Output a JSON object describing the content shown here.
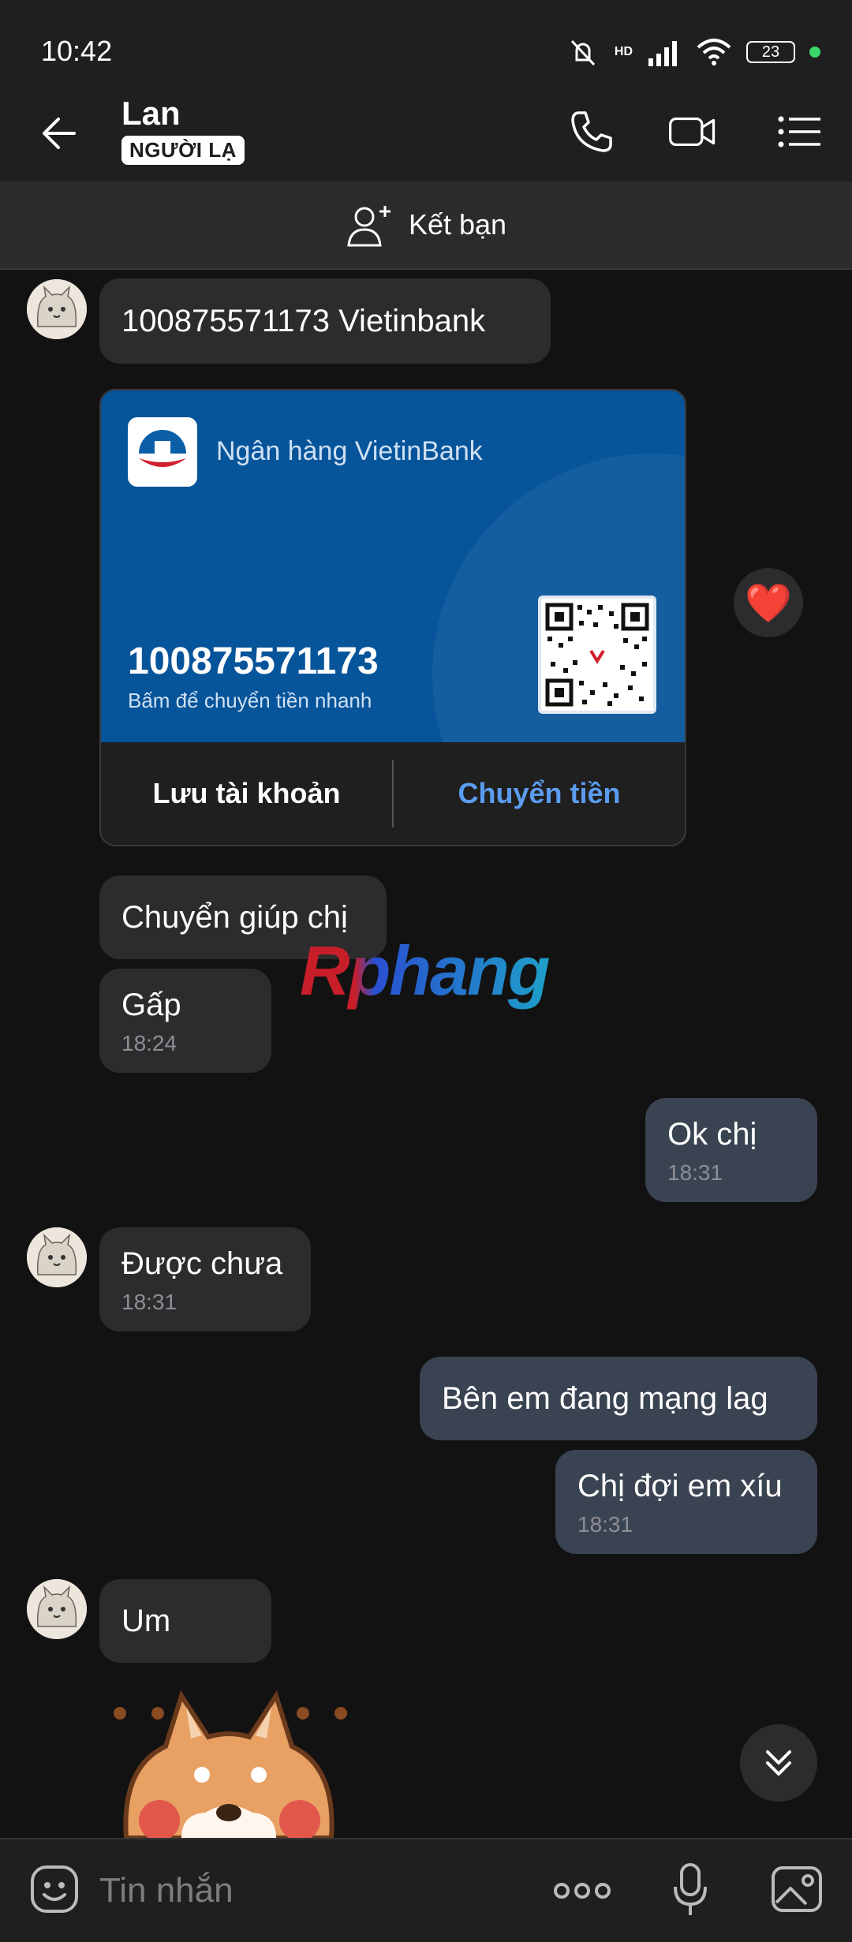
{
  "status_bar": {
    "time": "10:42",
    "battery": "23",
    "network": "HD"
  },
  "header": {
    "contact_name": "Lan",
    "badge": "NGƯỜI LẠ"
  },
  "friend_bar": {
    "label": "Kết bạn"
  },
  "messages": {
    "m1": {
      "text": "100875571173 Vietinbank"
    },
    "card": {
      "bank_name": "Ngân hàng VietinBank",
      "account_number": "100875571173",
      "subtitle": "Bấm để chuyển tiền nhanh",
      "save_label": "Lưu tài khoản",
      "transfer_label": "Chuyển tiền",
      "reaction": "❤️"
    },
    "m2": {
      "text": "Chuyển giúp chị"
    },
    "m3": {
      "text": "Gấp",
      "time": "18:24"
    },
    "m4": {
      "text": "Ok chị",
      "time": "18:31"
    },
    "m5": {
      "text": "Được chưa",
      "time": "18:31"
    },
    "m6": {
      "text": "Bên em đang mạng lag"
    },
    "m7": {
      "text": "Chị đợi em xíu",
      "time": "18:31"
    },
    "m8": {
      "text": "Um"
    }
  },
  "watermark": "Rphang",
  "input": {
    "placeholder": "Tin nhắn"
  },
  "colors": {
    "accent": "#5b9cf0",
    "card_blue": "#06549a",
    "outgoing": "#3a4352",
    "incoming": "#2c2c2e"
  }
}
